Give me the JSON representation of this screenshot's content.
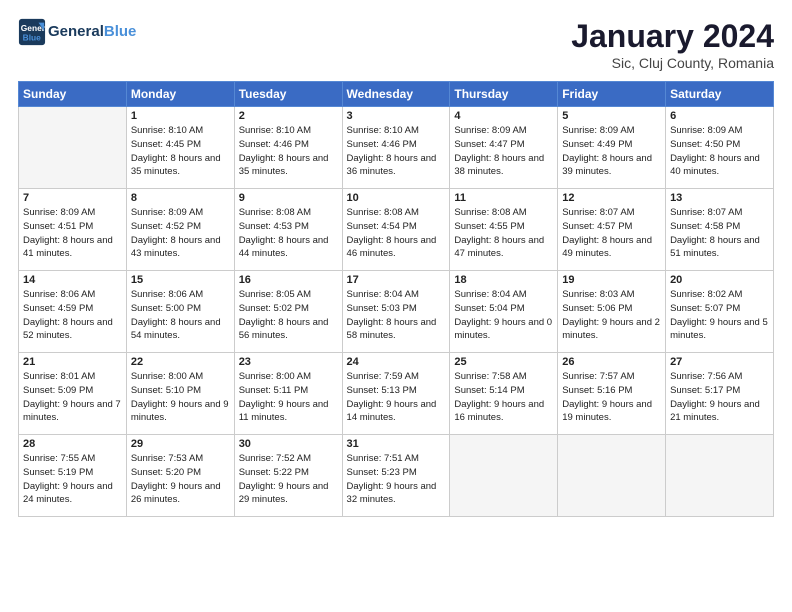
{
  "header": {
    "logo_line1": "General",
    "logo_line2": "Blue",
    "month_title": "January 2024",
    "subtitle": "Sic, Cluj County, Romania"
  },
  "days_of_week": [
    "Sunday",
    "Monday",
    "Tuesday",
    "Wednesday",
    "Thursday",
    "Friday",
    "Saturday"
  ],
  "weeks": [
    [
      {
        "num": "",
        "sunrise": "",
        "sunset": "",
        "daylight": "",
        "empty": true
      },
      {
        "num": "1",
        "sunrise": "Sunrise: 8:10 AM",
        "sunset": "Sunset: 4:45 PM",
        "daylight": "Daylight: 8 hours and 35 minutes."
      },
      {
        "num": "2",
        "sunrise": "Sunrise: 8:10 AM",
        "sunset": "Sunset: 4:46 PM",
        "daylight": "Daylight: 8 hours and 35 minutes."
      },
      {
        "num": "3",
        "sunrise": "Sunrise: 8:10 AM",
        "sunset": "Sunset: 4:46 PM",
        "daylight": "Daylight: 8 hours and 36 minutes."
      },
      {
        "num": "4",
        "sunrise": "Sunrise: 8:09 AM",
        "sunset": "Sunset: 4:47 PM",
        "daylight": "Daylight: 8 hours and 38 minutes."
      },
      {
        "num": "5",
        "sunrise": "Sunrise: 8:09 AM",
        "sunset": "Sunset: 4:49 PM",
        "daylight": "Daylight: 8 hours and 39 minutes."
      },
      {
        "num": "6",
        "sunrise": "Sunrise: 8:09 AM",
        "sunset": "Sunset: 4:50 PM",
        "daylight": "Daylight: 8 hours and 40 minutes."
      }
    ],
    [
      {
        "num": "7",
        "sunrise": "Sunrise: 8:09 AM",
        "sunset": "Sunset: 4:51 PM",
        "daylight": "Daylight: 8 hours and 41 minutes."
      },
      {
        "num": "8",
        "sunrise": "Sunrise: 8:09 AM",
        "sunset": "Sunset: 4:52 PM",
        "daylight": "Daylight: 8 hours and 43 minutes."
      },
      {
        "num": "9",
        "sunrise": "Sunrise: 8:08 AM",
        "sunset": "Sunset: 4:53 PM",
        "daylight": "Daylight: 8 hours and 44 minutes."
      },
      {
        "num": "10",
        "sunrise": "Sunrise: 8:08 AM",
        "sunset": "Sunset: 4:54 PM",
        "daylight": "Daylight: 8 hours and 46 minutes."
      },
      {
        "num": "11",
        "sunrise": "Sunrise: 8:08 AM",
        "sunset": "Sunset: 4:55 PM",
        "daylight": "Daylight: 8 hours and 47 minutes."
      },
      {
        "num": "12",
        "sunrise": "Sunrise: 8:07 AM",
        "sunset": "Sunset: 4:57 PM",
        "daylight": "Daylight: 8 hours and 49 minutes."
      },
      {
        "num": "13",
        "sunrise": "Sunrise: 8:07 AM",
        "sunset": "Sunset: 4:58 PM",
        "daylight": "Daylight: 8 hours and 51 minutes."
      }
    ],
    [
      {
        "num": "14",
        "sunrise": "Sunrise: 8:06 AM",
        "sunset": "Sunset: 4:59 PM",
        "daylight": "Daylight: 8 hours and 52 minutes."
      },
      {
        "num": "15",
        "sunrise": "Sunrise: 8:06 AM",
        "sunset": "Sunset: 5:00 PM",
        "daylight": "Daylight: 8 hours and 54 minutes."
      },
      {
        "num": "16",
        "sunrise": "Sunrise: 8:05 AM",
        "sunset": "Sunset: 5:02 PM",
        "daylight": "Daylight: 8 hours and 56 minutes."
      },
      {
        "num": "17",
        "sunrise": "Sunrise: 8:04 AM",
        "sunset": "Sunset: 5:03 PM",
        "daylight": "Daylight: 8 hours and 58 minutes."
      },
      {
        "num": "18",
        "sunrise": "Sunrise: 8:04 AM",
        "sunset": "Sunset: 5:04 PM",
        "daylight": "Daylight: 9 hours and 0 minutes."
      },
      {
        "num": "19",
        "sunrise": "Sunrise: 8:03 AM",
        "sunset": "Sunset: 5:06 PM",
        "daylight": "Daylight: 9 hours and 2 minutes."
      },
      {
        "num": "20",
        "sunrise": "Sunrise: 8:02 AM",
        "sunset": "Sunset: 5:07 PM",
        "daylight": "Daylight: 9 hours and 5 minutes."
      }
    ],
    [
      {
        "num": "21",
        "sunrise": "Sunrise: 8:01 AM",
        "sunset": "Sunset: 5:09 PM",
        "daylight": "Daylight: 9 hours and 7 minutes."
      },
      {
        "num": "22",
        "sunrise": "Sunrise: 8:00 AM",
        "sunset": "Sunset: 5:10 PM",
        "daylight": "Daylight: 9 hours and 9 minutes."
      },
      {
        "num": "23",
        "sunrise": "Sunrise: 8:00 AM",
        "sunset": "Sunset: 5:11 PM",
        "daylight": "Daylight: 9 hours and 11 minutes."
      },
      {
        "num": "24",
        "sunrise": "Sunrise: 7:59 AM",
        "sunset": "Sunset: 5:13 PM",
        "daylight": "Daylight: 9 hours and 14 minutes."
      },
      {
        "num": "25",
        "sunrise": "Sunrise: 7:58 AM",
        "sunset": "Sunset: 5:14 PM",
        "daylight": "Daylight: 9 hours and 16 minutes."
      },
      {
        "num": "26",
        "sunrise": "Sunrise: 7:57 AM",
        "sunset": "Sunset: 5:16 PM",
        "daylight": "Daylight: 9 hours and 19 minutes."
      },
      {
        "num": "27",
        "sunrise": "Sunrise: 7:56 AM",
        "sunset": "Sunset: 5:17 PM",
        "daylight": "Daylight: 9 hours and 21 minutes."
      }
    ],
    [
      {
        "num": "28",
        "sunrise": "Sunrise: 7:55 AM",
        "sunset": "Sunset: 5:19 PM",
        "daylight": "Daylight: 9 hours and 24 minutes."
      },
      {
        "num": "29",
        "sunrise": "Sunrise: 7:53 AM",
        "sunset": "Sunset: 5:20 PM",
        "daylight": "Daylight: 9 hours and 26 minutes."
      },
      {
        "num": "30",
        "sunrise": "Sunrise: 7:52 AM",
        "sunset": "Sunset: 5:22 PM",
        "daylight": "Daylight: 9 hours and 29 minutes."
      },
      {
        "num": "31",
        "sunrise": "Sunrise: 7:51 AM",
        "sunset": "Sunset: 5:23 PM",
        "daylight": "Daylight: 9 hours and 32 minutes."
      },
      {
        "num": "",
        "sunrise": "",
        "sunset": "",
        "daylight": "",
        "empty": true
      },
      {
        "num": "",
        "sunrise": "",
        "sunset": "",
        "daylight": "",
        "empty": true
      },
      {
        "num": "",
        "sunrise": "",
        "sunset": "",
        "daylight": "",
        "empty": true
      }
    ]
  ]
}
